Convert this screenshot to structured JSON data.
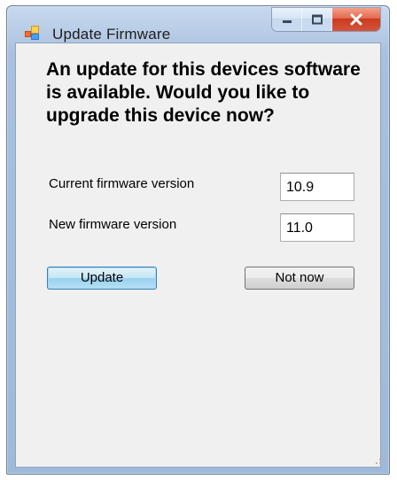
{
  "window": {
    "title": "Update Firmware",
    "icons": {
      "app": "app-icon",
      "minimize": "minimize-icon",
      "maximize": "maximize-icon",
      "close": "close-icon"
    }
  },
  "content": {
    "prompt": "An update for this devices software is available. Would you like to upgrade this device now?",
    "current_label": "Current firmware version",
    "current_value": "10.9",
    "new_label": "New firmware version",
    "new_value": "11.0"
  },
  "buttons": {
    "update": "Update",
    "not_now": "Not now"
  },
  "colors": {
    "close_red": "#c83b1f",
    "focus_blue": "#3c7fb1",
    "client_bg": "#f0f0f0"
  }
}
